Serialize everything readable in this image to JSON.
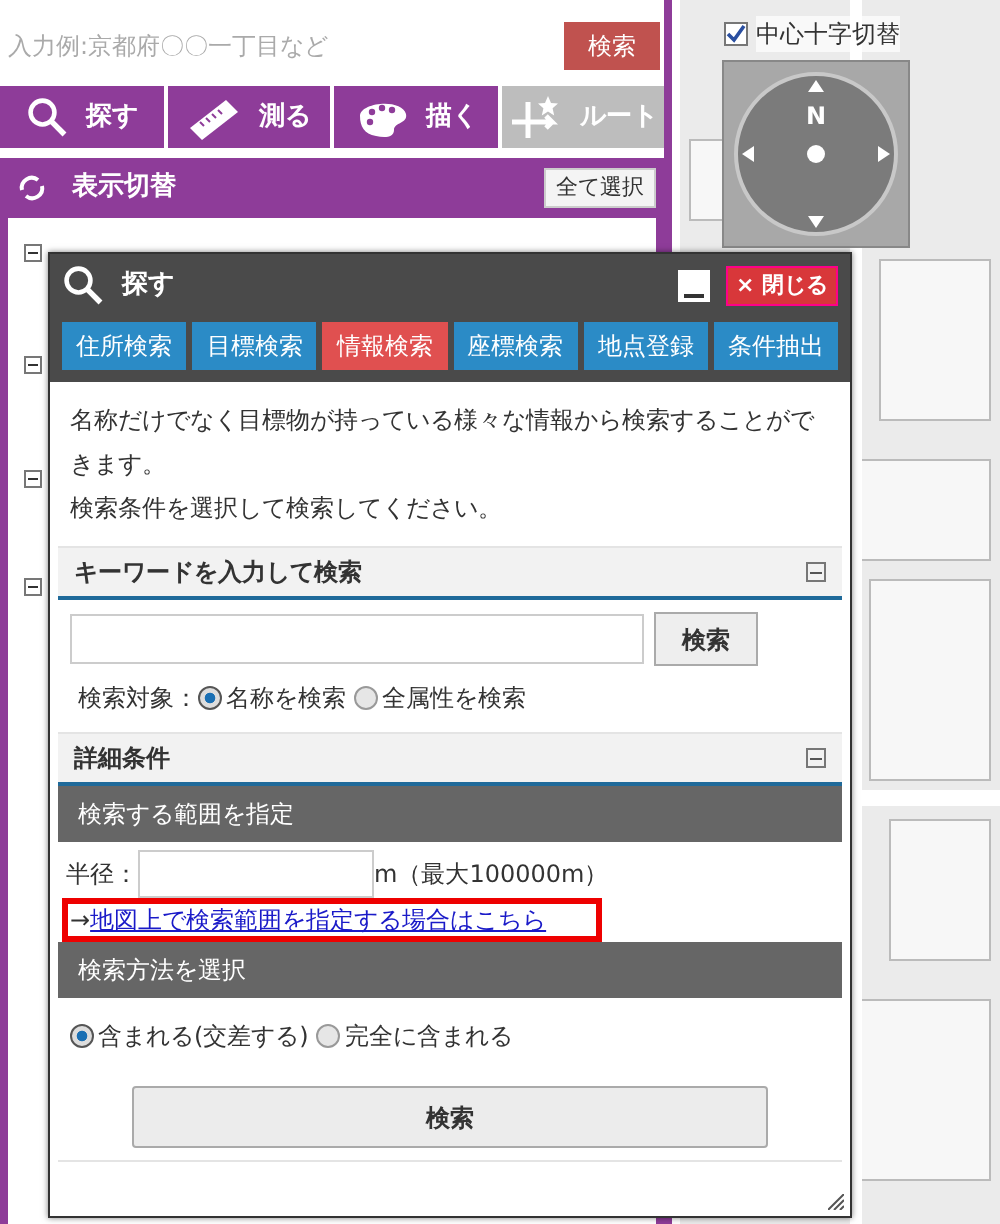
{
  "search_bar": {
    "placeholder": "入力例:京都府〇〇一丁目など",
    "button": "検索"
  },
  "tool_tabs": [
    {
      "label": "探す",
      "disabled": false
    },
    {
      "label": "測る",
      "disabled": false
    },
    {
      "label": "描く",
      "disabled": false
    },
    {
      "label": "ルート",
      "disabled": true
    }
  ],
  "layer_panel": {
    "title": "表示切替",
    "select_all": "全て選択",
    "tree_nodes": [
      {
        "expanded": true
      },
      {
        "expanded": true
      },
      {
        "expanded": true
      },
      {
        "expanded": true
      }
    ]
  },
  "map": {
    "crosshair_toggle": {
      "label": "中心十字切替",
      "checked": true
    },
    "compass_label": "N"
  },
  "dialog": {
    "title": "探す",
    "close": "× 閉じる",
    "tabs": [
      {
        "label": "住所検索",
        "selected": false
      },
      {
        "label": "目標検索",
        "selected": false
      },
      {
        "label": "情報検索",
        "selected": true
      },
      {
        "label": "座標検索",
        "selected": false
      },
      {
        "label": "地点登録",
        "selected": false
      },
      {
        "label": "条件抽出",
        "selected": false
      }
    ],
    "description": [
      "名称だけでなく目標物が持っている様々な情報から検索することができます。",
      "検索条件を選択して検索してください。"
    ],
    "keyword_section": {
      "title": "キーワードを入力して検索",
      "button": "検索",
      "target_label": "検索対象：",
      "options": [
        {
          "label": "名称を検索",
          "selected": true
        },
        {
          "label": "全属性を検索",
          "selected": false
        }
      ]
    },
    "detail_section": {
      "title": "詳細条件",
      "range_bar": "検索する範囲を指定",
      "radius_label": "半径：",
      "radius_unit": "m（最大100000m）",
      "map_link_arrow": "→",
      "map_link": "地図上で検索範囲を指定する場合はこちら",
      "method_bar": "検索方法を選択",
      "methods": [
        {
          "label": "含まれる(交差する)",
          "selected": true
        },
        {
          "label": "完全に含まれる",
          "selected": false
        }
      ],
      "search_button": "検索"
    }
  }
}
